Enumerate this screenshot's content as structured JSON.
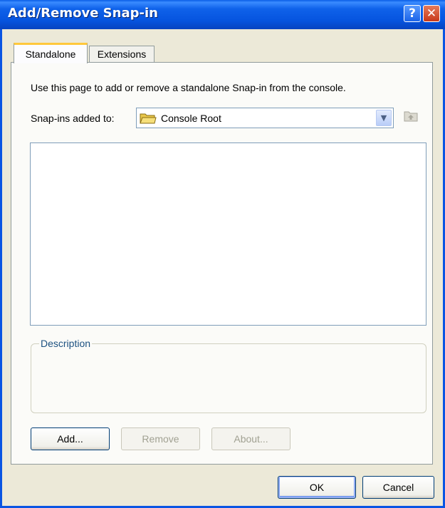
{
  "window": {
    "title": "Add/Remove Snap-in",
    "help_glyph": "?",
    "close_glyph": "✕"
  },
  "tabs": [
    {
      "label": "Standalone",
      "selected": true
    },
    {
      "label": "Extensions",
      "selected": false
    }
  ],
  "standalone": {
    "instructions": "Use this page to add or remove a standalone Snap-in from the console.",
    "snapins_label": "Snap-ins added to:",
    "snapins_combo": {
      "value": "Console Root",
      "icon": "folder-icon"
    },
    "up_folder_icon": "up-one-level-icon",
    "snapins_list": [],
    "description": {
      "legend": "Description",
      "text": ""
    },
    "buttons": {
      "add": {
        "label": "Add...",
        "enabled": true
      },
      "remove": {
        "label": "Remove",
        "enabled": false
      },
      "about": {
        "label": "About...",
        "enabled": false
      }
    }
  },
  "footer": {
    "ok_label": "OK",
    "cancel_label": "Cancel"
  },
  "colors": {
    "title_bar": "#0a55e3",
    "dialog_bg": "#ece9d8",
    "selected_tab_accent": "#ffc83c",
    "group_legend": "#1c5180",
    "close_button": "#c8381a"
  }
}
